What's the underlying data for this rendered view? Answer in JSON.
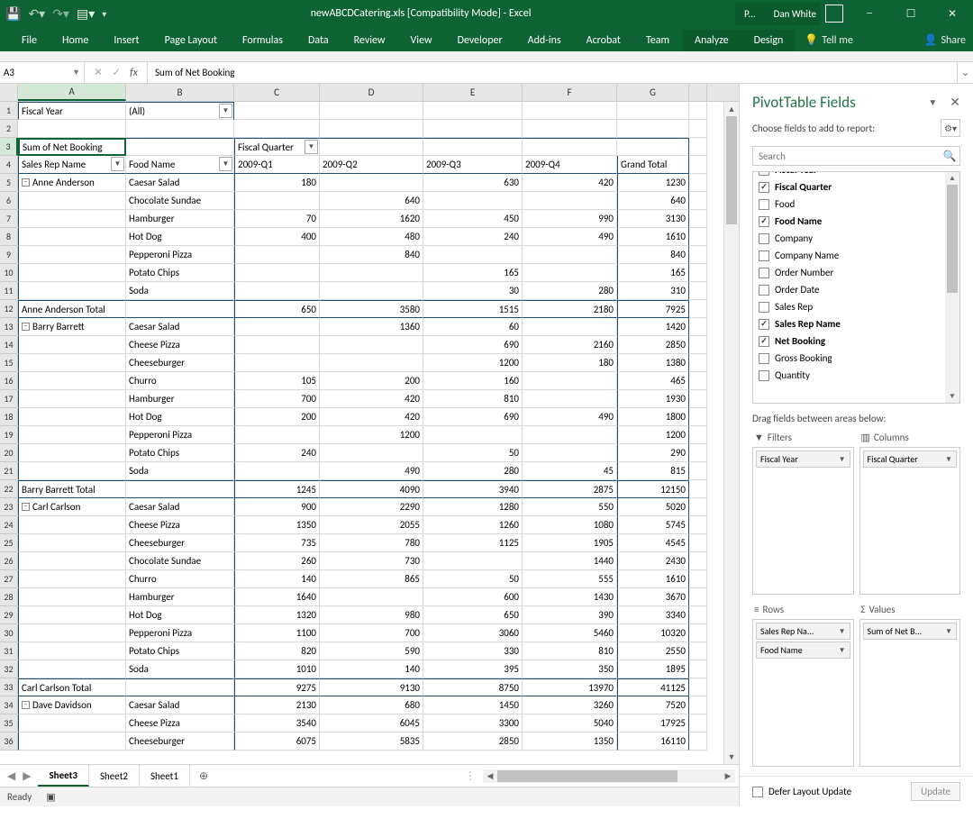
{
  "title": "newABCDCatering.xls  [Compatibility Mode] - Excel",
  "user": "Dan White",
  "ctx_tab": "P...",
  "ribbon_tabs": [
    "File",
    "Home",
    "Insert",
    "Page Layout",
    "Formulas",
    "Data",
    "Review",
    "View",
    "Developer",
    "Add-ins",
    "Acrobat",
    "Team",
    "Analyze",
    "Design"
  ],
  "tell_me": "Tell me",
  "share": "Share",
  "name_box": "A3",
  "formula": "Sum of Net Booking",
  "columns": [
    "A",
    "B",
    "C",
    "D",
    "E",
    "F",
    "G"
  ],
  "row1": {
    "a": "Fiscal Year",
    "b": "(All)"
  },
  "row3": {
    "a": "Sum of Net Booking",
    "c": "Fiscal Quarter"
  },
  "row4": {
    "a": "Sales Rep Name",
    "b": "Food Name",
    "c": "2009-Q1",
    "d": "2009-Q2",
    "e": "2009-Q3",
    "f": "2009-Q4",
    "g": "Grand Total"
  },
  "data_rows": [
    {
      "n": 5,
      "a": "Anne Anderson",
      "exp": true,
      "b": "Caesar Salad",
      "c": "180",
      "d": "",
      "e": "630",
      "f": "420",
      "g": "1230"
    },
    {
      "n": 6,
      "b": "Chocolate Sundae",
      "c": "",
      "d": "640",
      "e": "",
      "f": "",
      "g": "640"
    },
    {
      "n": 7,
      "b": "Hamburger",
      "c": "70",
      "d": "1620",
      "e": "450",
      "f": "990",
      "g": "3130"
    },
    {
      "n": 8,
      "b": "Hot Dog",
      "c": "400",
      "d": "480",
      "e": "240",
      "f": "490",
      "g": "1610"
    },
    {
      "n": 9,
      "b": "Pepperoni Pizza",
      "c": "",
      "d": "840",
      "e": "",
      "f": "",
      "g": "840"
    },
    {
      "n": 10,
      "b": "Potato Chips",
      "c": "",
      "d": "",
      "e": "165",
      "f": "",
      "g": "165"
    },
    {
      "n": 11,
      "b": "Soda",
      "c": "",
      "d": "",
      "e": "30",
      "f": "280",
      "g": "310"
    },
    {
      "n": 12,
      "total": true,
      "a": "Anne Anderson Total",
      "c": "650",
      "d": "3580",
      "e": "1515",
      "f": "2180",
      "g": "7925"
    },
    {
      "n": 13,
      "a": "Barry Barrett",
      "exp": true,
      "b": "Caesar Salad",
      "c": "",
      "d": "1360",
      "e": "60",
      "f": "",
      "g": "1420"
    },
    {
      "n": 14,
      "b": "Cheese Pizza",
      "c": "",
      "d": "",
      "e": "690",
      "f": "2160",
      "g": "2850"
    },
    {
      "n": 15,
      "b": "Cheeseburger",
      "c": "",
      "d": "",
      "e": "1200",
      "f": "180",
      "g": "1380"
    },
    {
      "n": 16,
      "b": "Churro",
      "c": "105",
      "d": "200",
      "e": "160",
      "f": "",
      "g": "465"
    },
    {
      "n": 17,
      "b": "Hamburger",
      "c": "700",
      "d": "420",
      "e": "810",
      "f": "",
      "g": "1930"
    },
    {
      "n": 18,
      "b": "Hot Dog",
      "c": "200",
      "d": "420",
      "e": "690",
      "f": "490",
      "g": "1800"
    },
    {
      "n": 19,
      "b": "Pepperoni Pizza",
      "c": "",
      "d": "1200",
      "e": "",
      "f": "",
      "g": "1200"
    },
    {
      "n": 20,
      "b": "Potato Chips",
      "c": "240",
      "d": "",
      "e": "50",
      "f": "",
      "g": "290"
    },
    {
      "n": 21,
      "b": "Soda",
      "c": "",
      "d": "490",
      "e": "280",
      "f": "45",
      "g": "815"
    },
    {
      "n": 22,
      "total": true,
      "a": "Barry Barrett Total",
      "c": "1245",
      "d": "4090",
      "e": "3940",
      "f": "2875",
      "g": "12150"
    },
    {
      "n": 23,
      "a": "Carl Carlson",
      "exp": true,
      "b": "Caesar Salad",
      "c": "900",
      "d": "2290",
      "e": "1280",
      "f": "550",
      "g": "5020"
    },
    {
      "n": 24,
      "b": "Cheese Pizza",
      "c": "1350",
      "d": "2055",
      "e": "1260",
      "f": "1080",
      "g": "5745"
    },
    {
      "n": 25,
      "b": "Cheeseburger",
      "c": "735",
      "d": "780",
      "e": "1125",
      "f": "1905",
      "g": "4545"
    },
    {
      "n": 26,
      "b": "Chocolate Sundae",
      "c": "260",
      "d": "730",
      "e": "",
      "f": "1440",
      "g": "2430"
    },
    {
      "n": 27,
      "b": "Churro",
      "c": "140",
      "d": "865",
      "e": "50",
      "f": "555",
      "g": "1610"
    },
    {
      "n": 28,
      "b": "Hamburger",
      "c": "1640",
      "d": "",
      "e": "600",
      "f": "1430",
      "g": "3670"
    },
    {
      "n": 29,
      "b": "Hot Dog",
      "c": "1320",
      "d": "980",
      "e": "650",
      "f": "390",
      "g": "3340"
    },
    {
      "n": 30,
      "b": "Pepperoni Pizza",
      "c": "1100",
      "d": "700",
      "e": "3060",
      "f": "5460",
      "g": "10320"
    },
    {
      "n": 31,
      "b": "Potato Chips",
      "c": "820",
      "d": "590",
      "e": "330",
      "f": "810",
      "g": "2550"
    },
    {
      "n": 32,
      "b": "Soda",
      "c": "1010",
      "d": "140",
      "e": "395",
      "f": "350",
      "g": "1895"
    },
    {
      "n": 33,
      "total": true,
      "a": "Carl Carlson Total",
      "c": "9275",
      "d": "9130",
      "e": "8750",
      "f": "13970",
      "g": "41125"
    },
    {
      "n": 34,
      "a": "Dave Davidson",
      "exp": true,
      "b": "Caesar Salad",
      "c": "2130",
      "d": "680",
      "e": "1450",
      "f": "3260",
      "g": "7520"
    },
    {
      "n": 35,
      "b": "Cheese Pizza",
      "c": "3540",
      "d": "6045",
      "e": "3300",
      "f": "5040",
      "g": "17925"
    },
    {
      "n": 36,
      "b": "Cheeseburger",
      "c": "6075",
      "d": "5835",
      "e": "2850",
      "f": "1350",
      "g": "16110"
    }
  ],
  "fields_header": "PivotTable Fields",
  "fields_sub": "Choose fields to add to report:",
  "search_placeholder": "Search",
  "field_list": [
    {
      "name": "Fiscal Year",
      "checked": true,
      "cut": true
    },
    {
      "name": "Fiscal Quarter",
      "checked": true
    },
    {
      "name": "Food",
      "checked": false
    },
    {
      "name": "Food Name",
      "checked": true
    },
    {
      "name": "Company",
      "checked": false
    },
    {
      "name": "Company Name",
      "checked": false
    },
    {
      "name": "Order Number",
      "checked": false
    },
    {
      "name": "Order Date",
      "checked": false
    },
    {
      "name": "Sales Rep",
      "checked": false
    },
    {
      "name": "Sales Rep Name",
      "checked": true
    },
    {
      "name": "Net Booking",
      "checked": true
    },
    {
      "name": "Gross Booking",
      "checked": false
    },
    {
      "name": "Quantity",
      "checked": false
    }
  ],
  "drag_label": "Drag fields between areas below:",
  "areas": {
    "filters": {
      "label": "Filters",
      "items": [
        "Fiscal Year"
      ]
    },
    "columns": {
      "label": "Columns",
      "items": [
        "Fiscal Quarter"
      ]
    },
    "rows": {
      "label": "Rows",
      "items": [
        "Sales Rep Na...",
        "Food Name"
      ]
    },
    "values": {
      "label": "Values",
      "items": [
        "Sum of Net B..."
      ]
    }
  },
  "defer_label": "Defer Layout Update",
  "update_btn": "Update",
  "sheets": [
    "Sheet3",
    "Sheet2",
    "Sheet1"
  ],
  "status": "Ready"
}
